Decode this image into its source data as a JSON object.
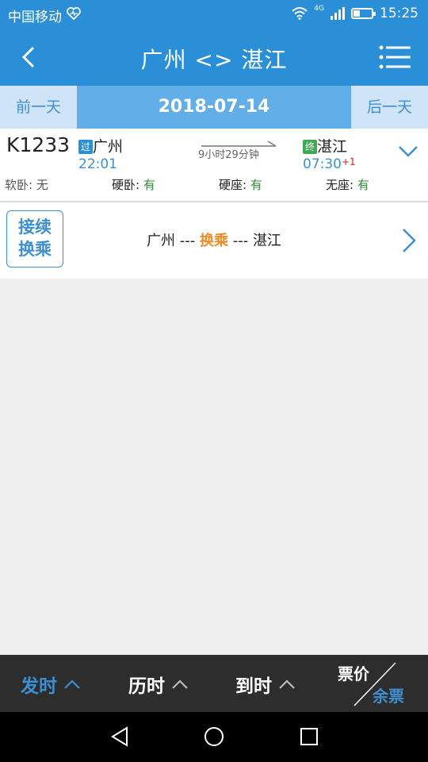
{
  "status": {
    "carrier": "中国移动",
    "network": "4G",
    "time": "15:25",
    "battery_level": 0.35
  },
  "header": {
    "title": "广州 <> 湛江"
  },
  "datebar": {
    "prev_label": "前一天",
    "date": "2018-07-14",
    "next_label": "后一天"
  },
  "train": {
    "code": "K1233",
    "from_badge": "过",
    "from": "广州",
    "depart": "22:01",
    "duration": "9小时29分钟",
    "to_badge": "终",
    "to": "湛江",
    "arrive": "07:30",
    "day_offset": "+1",
    "seats": [
      {
        "label": "软卧:",
        "value": "无"
      },
      {
        "label": "硬卧:",
        "value": "有"
      },
      {
        "label": "硬座:",
        "value": "有"
      },
      {
        "label": "无座:",
        "value": "有"
      }
    ]
  },
  "transfer": {
    "tag_line1": "接续",
    "tag_line2": "换乘",
    "from": "广州",
    "sep1": " --- ",
    "middle": "换乘",
    "sep2": " --- ",
    "to": "湛江"
  },
  "bottom": {
    "sort_depart": "发时",
    "sort_duration": "历时",
    "sort_arrive": "到时",
    "price": "票价",
    "remaining": "余票"
  },
  "colors": {
    "primary": "#2a8fd6",
    "available": "#2e8b3a",
    "highlight": "#f08a24"
  }
}
